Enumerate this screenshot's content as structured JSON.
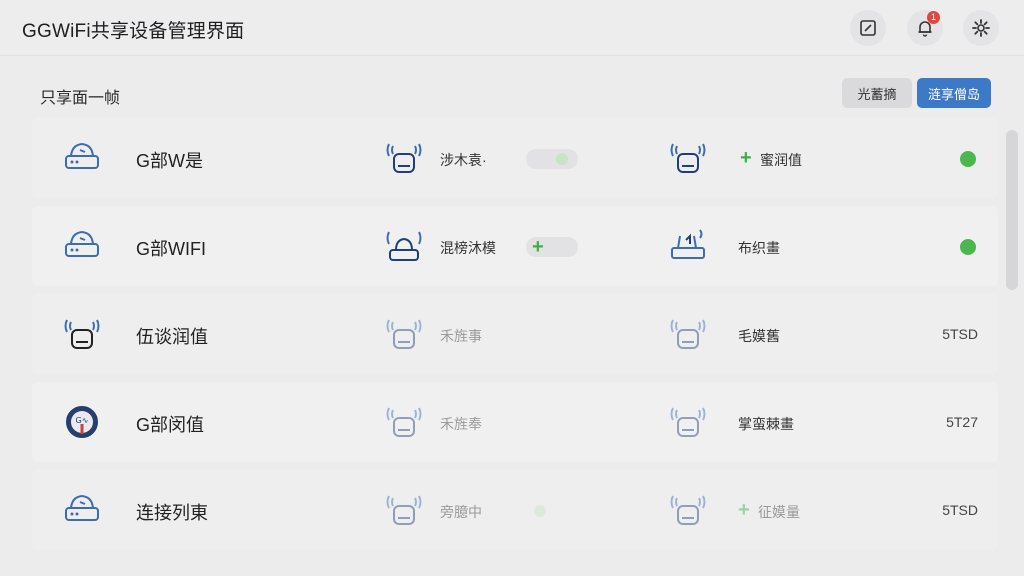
{
  "header": {
    "title": "GGWiFi共享设备管理界面",
    "notification_count": "1"
  },
  "section": {
    "title": "只享面一帧",
    "btn_secondary": "光蓄摘",
    "btn_primary": "涟享僧岛"
  },
  "rows": [
    {
      "name": "G部W是",
      "secondary_label": "涉木袁·",
      "tertiary_label": "蜜润值",
      "status": "online"
    },
    {
      "name": "G部WIFI",
      "secondary_label": "混榜沐模",
      "tertiary_label": "布织畫",
      "status": "online"
    },
    {
      "name": "伍谈润值",
      "secondary_label": "禾旌事",
      "tertiary_label": "毛嫫舊",
      "code": "5TSD"
    },
    {
      "name": "G部闵值",
      "secondary_label": "禾旌奉",
      "tertiary_label": "掌蛮棘畫",
      "code": "5T27"
    },
    {
      "name": "连接列東",
      "secondary_label": "旁臆中",
      "tertiary_label": "征嫫量",
      "code": "5TSD"
    }
  ],
  "colors": {
    "accent": "#3d79c6",
    "online": "#4cb74e",
    "plus": "#3fae43",
    "badge": "#e0453e"
  },
  "icons": {
    "edit": "edit-square-icon",
    "notification": "bell-icon",
    "settings": "gear-icon",
    "router": "router-icon",
    "wifi_device": "wifi-router-icon",
    "gauge": "gauge-icon",
    "add": "plus-icon"
  }
}
